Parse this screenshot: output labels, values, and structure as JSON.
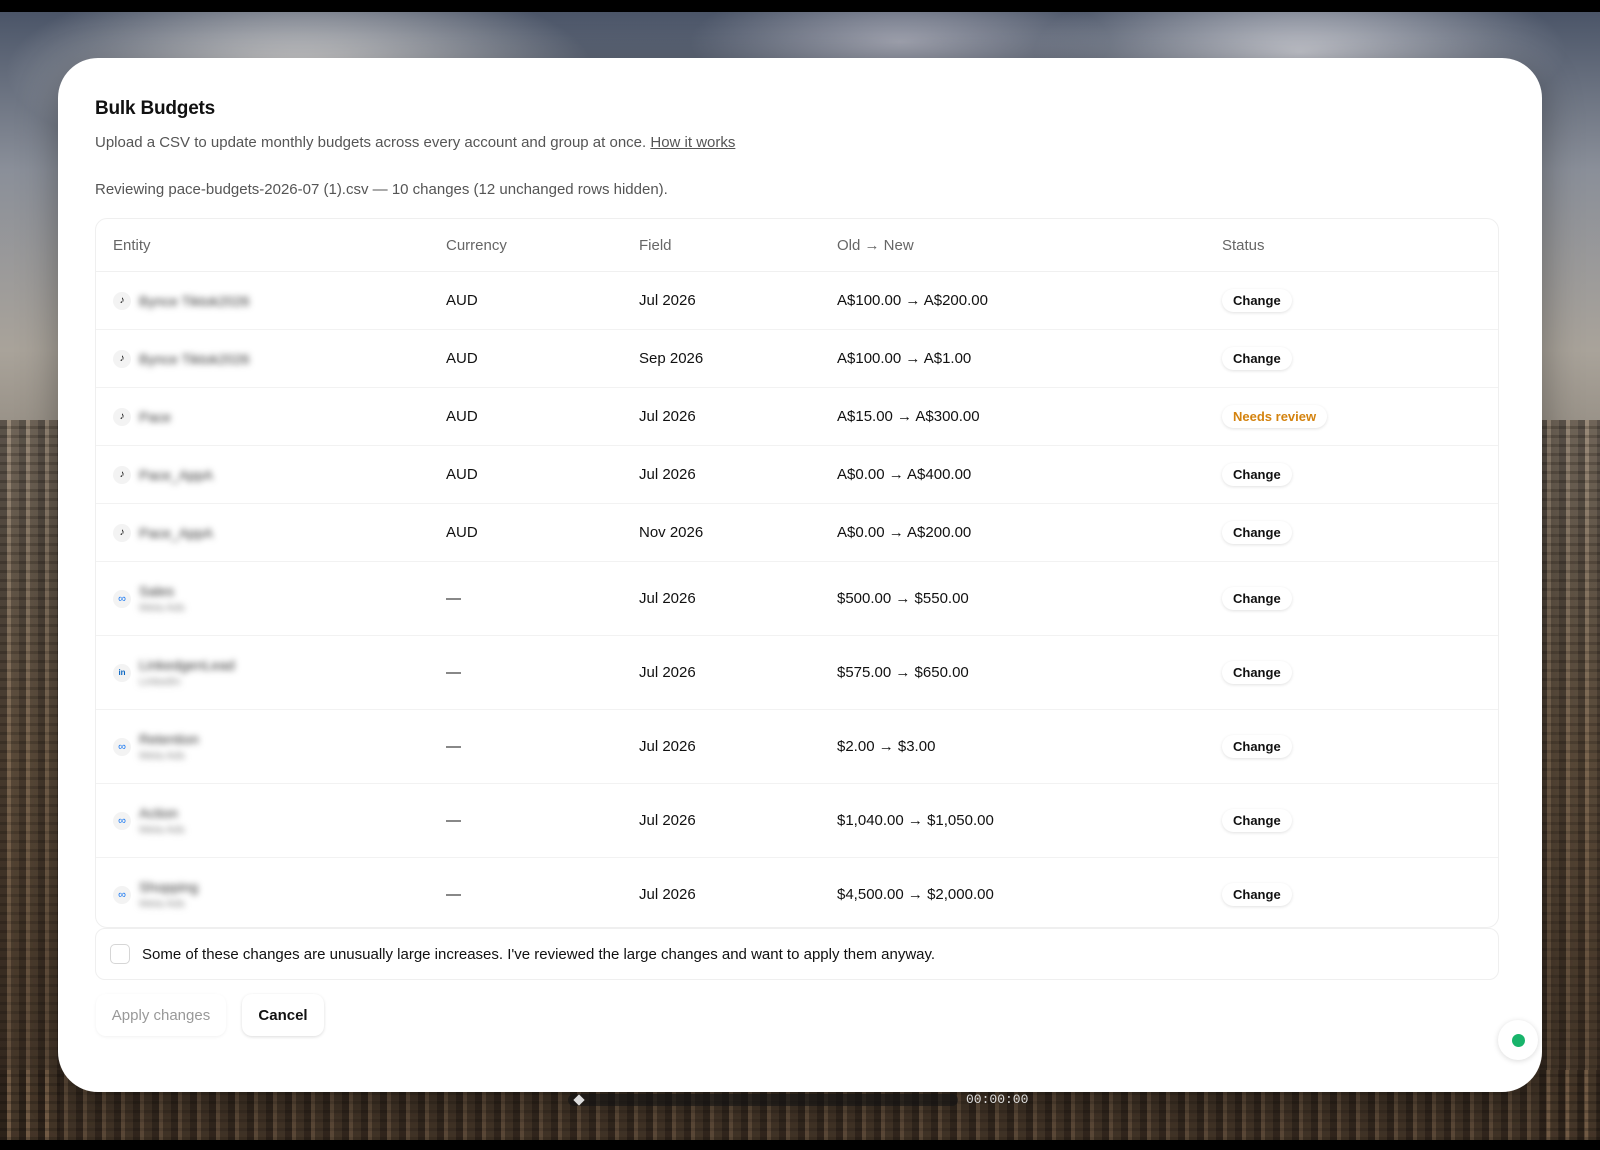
{
  "dialog": {
    "title": "Bulk Budgets",
    "subtitle": "Upload a CSV to update monthly budgets across every account and group at once.",
    "help_link": "How it works",
    "review_note": "Reviewing pace-budgets-2026-07 (1).csv — 10 changes (12 unchanged rows hidden)."
  },
  "table": {
    "columns": {
      "entity": "Entity",
      "currency": "Currency",
      "field": "Field",
      "change": "Old → New",
      "status": "Status"
    },
    "rows": [
      {
        "platform_icon": "tiktok-icon",
        "entity": "Bynce Tiktok2026",
        "entity_sub": "",
        "currency": "AUD",
        "field": "Jul 2026",
        "change": "A$100.00 → A$200.00",
        "status": "Change"
      },
      {
        "platform_icon": "tiktok-icon",
        "entity": "Bynce Tiktok2026",
        "entity_sub": "",
        "currency": "AUD",
        "field": "Sep 2026",
        "change": "A$100.00 → A$1.00",
        "status": "Change"
      },
      {
        "platform_icon": "tiktok-icon",
        "entity": "Pace",
        "entity_sub": "",
        "currency": "AUD",
        "field": "Jul 2026",
        "change": "A$15.00 → A$300.00",
        "status": "Needs review"
      },
      {
        "platform_icon": "tiktok-icon",
        "entity": "Pace_AppA",
        "entity_sub": "",
        "currency": "AUD",
        "field": "Jul 2026",
        "change": "A$0.00 → A$400.00",
        "status": "Change"
      },
      {
        "platform_icon": "tiktok-icon",
        "entity": "Pace_AppA",
        "entity_sub": "",
        "currency": "AUD",
        "field": "Nov 2026",
        "change": "A$0.00 → A$200.00",
        "status": "Change"
      },
      {
        "platform_icon": "meta-icon",
        "entity": "Sales",
        "entity_sub": "Meta Ads",
        "currency": "—",
        "field": "Jul 2026",
        "change": "$500.00 → $550.00",
        "status": "Change"
      },
      {
        "platform_icon": "linkedin-icon",
        "entity": "LinkedgenLead",
        "entity_sub": "LinkedIn",
        "currency": "—",
        "field": "Jul 2026",
        "change": "$575.00 → $650.00",
        "status": "Change"
      },
      {
        "platform_icon": "meta-icon",
        "entity": "Retention",
        "entity_sub": "Meta Ads",
        "currency": "—",
        "field": "Jul 2026",
        "change": "$2.00 → $3.00",
        "status": "Change"
      },
      {
        "platform_icon": "meta-icon",
        "entity": "Action",
        "entity_sub": "Meta Ads",
        "currency": "—",
        "field": "Jul 2026",
        "change": "$1,040.00 → $1,050.00",
        "status": "Change"
      },
      {
        "platform_icon": "meta-icon",
        "entity": "Shopping",
        "entity_sub": "Meta Ads",
        "currency": "—",
        "field": "Jul 2026",
        "change": "$4,500.00 → $2,000.00",
        "status": "Change"
      }
    ]
  },
  "confirmation": {
    "label": "Some of these changes are unusually large increases. I've reviewed the large changes and want to apply them anyway.",
    "checked": false
  },
  "actions": {
    "apply": "Apply changes",
    "cancel": "Cancel"
  },
  "player": {
    "time": "00:00:00"
  },
  "colors": {
    "needs_review": "#d4830f",
    "status_dot": "#18b46b"
  }
}
